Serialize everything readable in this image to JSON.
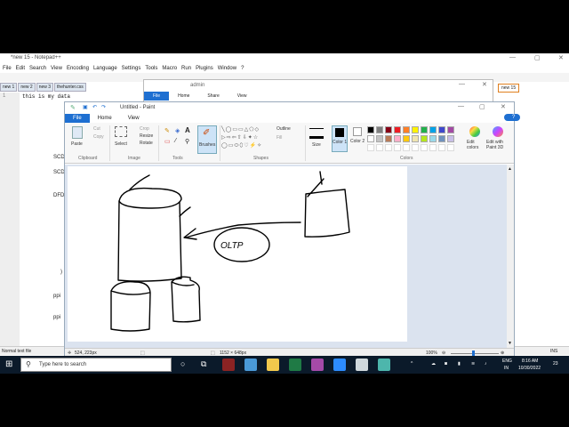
{
  "notepad": {
    "title": "*new 15 - Notepad++",
    "menu": [
      "File",
      "Edit",
      "Search",
      "View",
      "Encoding",
      "Language",
      "Settings",
      "Tools",
      "Macro",
      "Run",
      "Plugins",
      "Window",
      "?"
    ],
    "tabs": [
      "new 1",
      "new 2",
      "new 3",
      "thehunter.css"
    ],
    "active_tab": "new 15",
    "line_number": "1",
    "editor_text": "this is my data",
    "fragments": [
      "SCD",
      "SCD",
      "DFD",
      ")",
      "ppi",
      "ppi"
    ],
    "status_left": "Normal text file",
    "status_right": "INS"
  },
  "explorer": {
    "title": "admin",
    "tabs": [
      "File",
      "Home",
      "Share",
      "View"
    ]
  },
  "paint": {
    "title": "Untitled - Paint",
    "tabs": [
      "File",
      "Home",
      "View"
    ],
    "clipboard": {
      "paste": "Paste",
      "cut": "Cut",
      "copy": "Copy",
      "group": "Clipboard"
    },
    "image": {
      "select": "Select",
      "crop": "Crop",
      "resize": "Resize",
      "rotate": "Rotate",
      "group": "Image"
    },
    "tools_group": "Tools",
    "brushes": "Brushes",
    "shapes": {
      "outline": "Outline",
      "fill": "Fill",
      "group": "Shapes"
    },
    "size": "Size",
    "color1": "Color 1",
    "color2": "Color 2",
    "colors_group": "Colors",
    "edit_colors": "Edit colors",
    "edit_3d": "Edit with Paint 3D",
    "palette": [
      "#000000",
      "#7f7f7f",
      "#880015",
      "#ed1c24",
      "#ff7f27",
      "#fff200",
      "#22b14c",
      "#00a2e8",
      "#3f48cc",
      "#a349a4",
      "#ffffff",
      "#c3c3c3",
      "#b97a57",
      "#ffaec9",
      "#ffc90e",
      "#efe4b0",
      "#b5e61d",
      "#99d9ea",
      "#7092be",
      "#c8bfe7"
    ],
    "canvas_label": "OLTP",
    "status": {
      "cursor": "524, 223px",
      "size": "1152 × 648px",
      "zoom": "100%"
    }
  },
  "taskbar": {
    "search_placeholder": "Type here to search",
    "lang": "ENG",
    "region": "IN",
    "time": "8:16 AM",
    "date": "10/30/2022",
    "notif": "23"
  }
}
